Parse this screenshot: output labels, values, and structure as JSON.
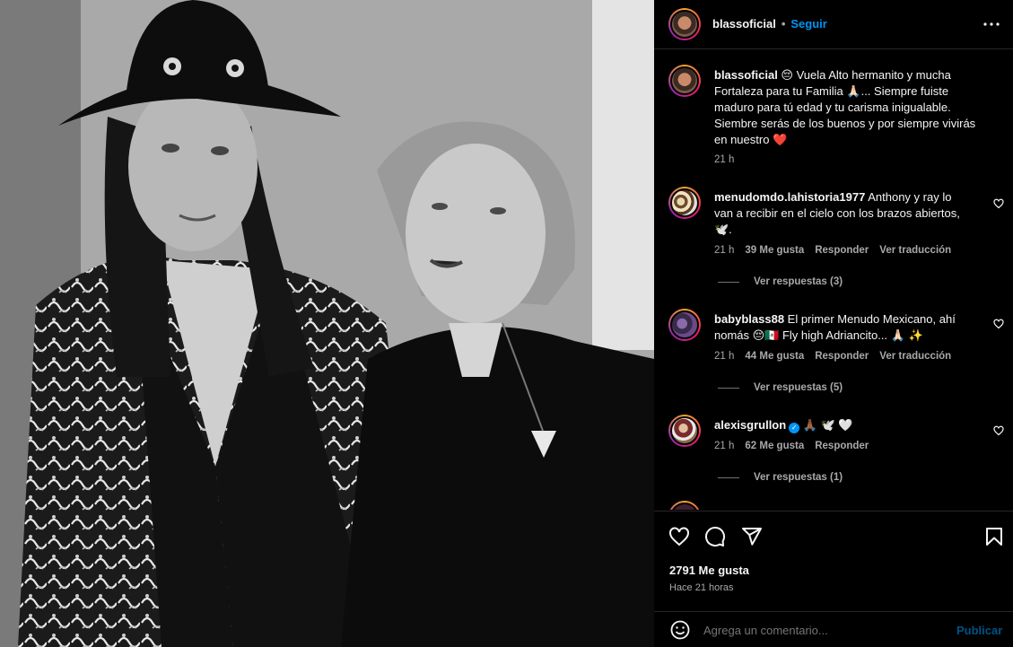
{
  "post": {
    "username": "blassoficial",
    "dot": "•",
    "follow_label": "Seguir",
    "caption_user": "blassoficial",
    "caption_line1": " 😔 Vuela Alto hermanito y mucha",
    "caption_line2": "Fortaleza para tu Familia 🙏🏻... Siempre fuiste",
    "caption_line3": "maduro para tú edad y tu carisma inigualable.",
    "caption_line4": "Siembre serás de los buenos y por siempre vivirás",
    "caption_line5": "en nuestro ❤️",
    "caption_time": "21 h"
  },
  "comments": [
    {
      "user": "menudomdo.lahistoria1977",
      "line1": " Anthony y ray lo",
      "line2": "van a recibir en el cielo con los brazos abiertos,",
      "line3": "🕊️.",
      "time": "21 h",
      "likes": "39 Me gusta",
      "reply": "Responder",
      "translate": "Ver traducción",
      "view_replies": "Ver respuestas (3)"
    },
    {
      "user": "babyblass88",
      "line1": " El primer Menudo Mexicano, ahí",
      "line2": "nomás 😔🇲🇽 Fly high Adriancito... 🙏🏻 ✨",
      "time": "21 h",
      "likes": "44 Me gusta",
      "reply": "Responder",
      "translate": "Ver traducción",
      "view_replies": "Ver respuestas (5)"
    },
    {
      "user": "alexisgrullon",
      "line1": " 🙏🏾 🕊️ 🤍",
      "time": "21 h",
      "likes": "62 Me gusta",
      "reply": "Responder",
      "view_replies": "Ver respuestas (1)"
    }
  ],
  "stats": {
    "likes": "2791 Me gusta",
    "time": "Hace 21 horas"
  },
  "composer": {
    "placeholder": "Agrega un comentario...",
    "publish": "Publicar"
  },
  "icons": {
    "like": "heart-icon",
    "comment": "comment-icon",
    "share": "send-icon",
    "save": "bookmark-icon",
    "more": "more-icon",
    "emoji": "emoji-icon"
  },
  "colors": {
    "accent": "#0095f6",
    "heart": "#ed4956"
  }
}
